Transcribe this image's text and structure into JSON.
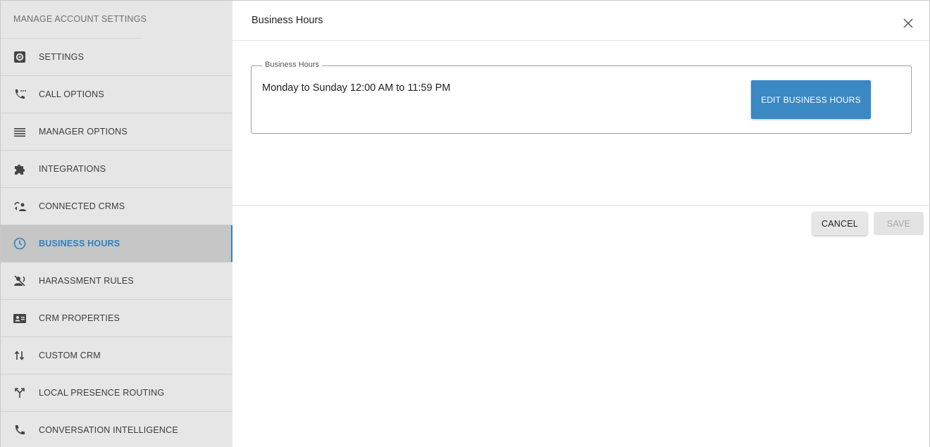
{
  "sidebar": {
    "title": "MANAGE ACCOUNT SETTINGS",
    "items": [
      {
        "label": "SETTINGS",
        "icon": "gear-square-icon"
      },
      {
        "label": "CALL OPTIONS",
        "icon": "phone-dots-icon"
      },
      {
        "label": "MANAGER OPTIONS",
        "icon": "menu-lines-icon"
      },
      {
        "label": "INTEGRATIONS",
        "icon": "puzzle-icon"
      },
      {
        "label": "CONNECTED CRMS",
        "icon": "connected-crm-icon"
      },
      {
        "label": "BUSINESS HOURS",
        "icon": "clock-icon",
        "active": true
      },
      {
        "label": "HARASSMENT RULES",
        "icon": "voice-off-icon"
      },
      {
        "label": "CRM PROPERTIES",
        "icon": "contact-card-icon"
      },
      {
        "label": "CUSTOM CRM",
        "icon": "swap-vertical-icon"
      },
      {
        "label": "LOCAL PRESENCE ROUTING",
        "icon": "call-split-icon"
      },
      {
        "label": "CONVERSATION INTELLIGENCE",
        "icon": "phone-icon"
      }
    ]
  },
  "main": {
    "title": "Business Hours",
    "section_legend": "Business Hours",
    "hours_text": "Monday to Sunday 12:00 AM to 11:59 PM",
    "edit_label": "EDIT BUSINESS HOURS",
    "cancel_label": "CANCEL",
    "save_label": "SAVE"
  },
  "colors": {
    "accent": "#2f80c0",
    "edit_button": "#3a88c4",
    "sidebar_bg": "#e6e6e6",
    "active_bg": "#c6c6c6"
  }
}
